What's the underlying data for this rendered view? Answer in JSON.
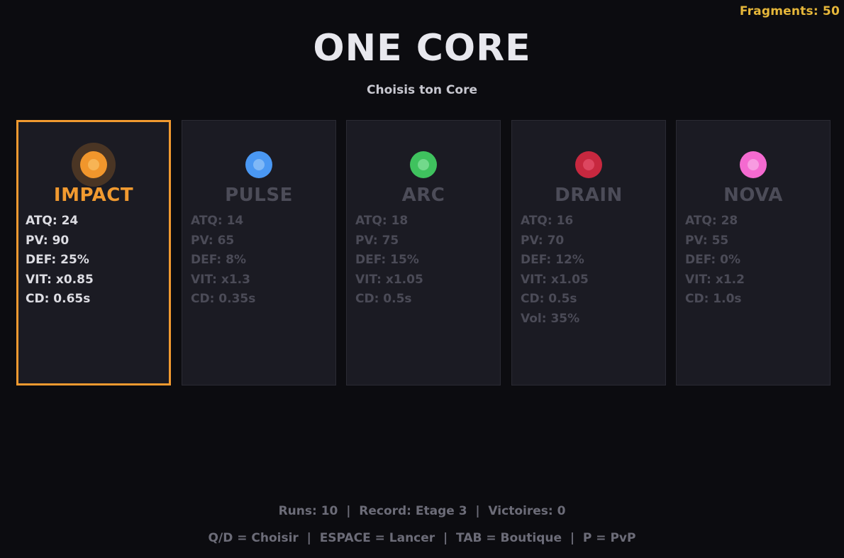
{
  "hud": {
    "fragments": "Fragments: 50"
  },
  "title": "ONE CORE",
  "subtitle": "Choisis ton Core",
  "colors": {
    "accent": "#f19a30",
    "fragments": "#e6b73a",
    "background": "#0c0c10",
    "card": "#1b1b23"
  },
  "cores": [
    {
      "name": "IMPACT",
      "selected": true,
      "color": "#f1962c",
      "inner": "#f7b455",
      "glow": "#4a3524",
      "stats": [
        "ATQ: 24",
        "PV: 90",
        "DEF: 25%",
        "VIT: x0.85",
        "CD: 0.65s"
      ]
    },
    {
      "name": "PULSE",
      "selected": false,
      "color": "#4a98f3",
      "inner": "#7fb8f7",
      "stats": [
        "ATQ: 14",
        "PV: 65",
        "DEF: 8%",
        "VIT: x1.3",
        "CD: 0.35s"
      ]
    },
    {
      "name": "ARC",
      "selected": false,
      "color": "#3fc25e",
      "inner": "#72d98b",
      "stats": [
        "ATQ: 18",
        "PV: 75",
        "DEF: 15%",
        "VIT: x1.05",
        "CD: 0.5s"
      ]
    },
    {
      "name": "DRAIN",
      "selected": false,
      "color": "#c7283f",
      "inner": "#dd4660",
      "stats": [
        "ATQ: 16",
        "PV: 70",
        "DEF: 12%",
        "VIT: x1.05",
        "CD: 0.5s",
        "Vol: 35%"
      ]
    },
    {
      "name": "NOVA",
      "selected": false,
      "color": "#f46ad0",
      "inner": "#f89be1",
      "stats": [
        "ATQ: 28",
        "PV: 55",
        "DEF: 0%",
        "VIT: x1.2",
        "CD: 1.0s"
      ]
    }
  ],
  "footer": {
    "stats_line": "Runs: 10  |  Record: Etage 3  |  Victoires: 0",
    "controls_line": "Q/D = Choisir  |  ESPACE = Lancer  |  TAB = Boutique  |  P = PvP"
  }
}
